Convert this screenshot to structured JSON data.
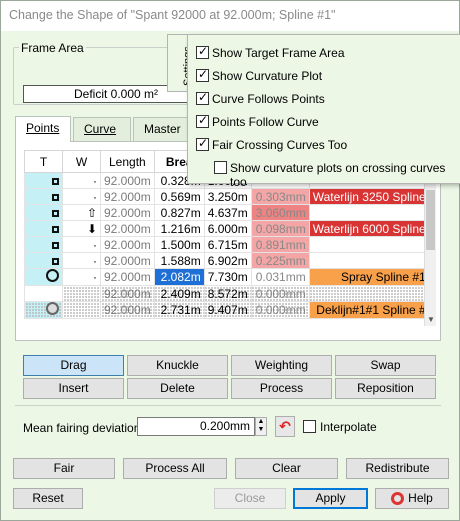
{
  "window": {
    "title": "Change the Shape of \"Spant  92000 at 92.000m; Spline #1\""
  },
  "frame_area": {
    "label": "Frame Area",
    "deficit": "Deficit 0.000 m²"
  },
  "tabs": [
    {
      "label": "Points",
      "active": true
    },
    {
      "label": "Curve",
      "active": false
    },
    {
      "label": "Master",
      "active": false
    }
  ],
  "table": {
    "columns": [
      "T",
      "W",
      "Length",
      "Brea"
    ],
    "rows": [
      {
        "t": "square",
        "w": "·",
        "length": "92.000m",
        "break": "0.328m",
        "c5": "1.007m",
        "c6": "",
        "label": "",
        "label_style": ""
      },
      {
        "t": "square",
        "w": "·",
        "length": "92.000m",
        "break": "0.569m",
        "c5": "3.250m",
        "c6": "0.303mm",
        "label": "Waterlijn   3250 Spline",
        "label_style": "red"
      },
      {
        "t": "square",
        "w": "⇧",
        "length": "92.000m",
        "break": "0.827m",
        "c5": "4.637m",
        "c6": "3.060mm",
        "label": "",
        "label_style": ""
      },
      {
        "t": "square",
        "w": "⬇",
        "length": "92.000m",
        "break": "1.216m",
        "c5": "6.000m",
        "c6": "0.098mm",
        "label": "Waterlijn   6000 Spline",
        "label_style": "red"
      },
      {
        "t": "square",
        "w": "·",
        "length": "92.000m",
        "break": "1.500m",
        "c5": "6.715m",
        "c6": "0.891mm",
        "label": "",
        "label_style": ""
      },
      {
        "t": "square",
        "w": "·",
        "length": "92.000m",
        "break": "1.588m",
        "c5": "6.902m",
        "c6": "0.225mm",
        "label": "",
        "label_style": ""
      },
      {
        "t": "circle",
        "w": "·",
        "length": "92.000m",
        "break": "2.082m",
        "c5": "7.730m",
        "c6": "0.031mm",
        "label": "Spray Spline #1",
        "label_style": "orange"
      },
      {
        "t": "",
        "w": "",
        "length": "92.000m",
        "break": "2.409m",
        "c5": "8.572m",
        "c6": "0.000mm",
        "label": "",
        "label_style": ""
      },
      {
        "t": "circle-grey",
        "w": "",
        "length": "92.000m",
        "break": "2.731m",
        "c5": "9.407m",
        "c6": "0.000mm",
        "label": "Deklijn#1#1 Spline #",
        "label_style": "orange"
      }
    ]
  },
  "tool_buttons": {
    "drag": "Drag",
    "knuckle": "Knuckle",
    "weighting": "Weighting",
    "swap": "Swap",
    "insert": "Insert",
    "delete": "Delete",
    "process": "Process",
    "reposition": "Reposition"
  },
  "fairing": {
    "label": "Mean fairing deviation:",
    "value": "0.200mm",
    "interpolate_label": "Interpolate"
  },
  "bottom_buttons": {
    "fair": "Fair",
    "process_all": "Process All",
    "clear": "Clear",
    "redistribute": "Redistribute",
    "reset": "Reset",
    "close": "Close",
    "apply": "Apply",
    "help": "Help"
  },
  "settings": {
    "tab_label": "Settings",
    "options": [
      {
        "label": "Show Target Frame Area",
        "checked": true
      },
      {
        "label": "Show Curvature Plot",
        "checked": true
      },
      {
        "label": "Curve Follows Points",
        "checked": true
      },
      {
        "label": "Points Follow Curve",
        "checked": true
      },
      {
        "label": "Fair Crossing Curves Too",
        "checked": true
      },
      {
        "label": "Show curvature plots on crossing curves too",
        "checked": false
      }
    ]
  },
  "colors": {
    "selection": "#1e6fd6",
    "label_red": "#d93434",
    "label_orange": "#f8a04a",
    "deviation_pink": "#f4a6a6",
    "t_column": "#c5f0f6"
  }
}
